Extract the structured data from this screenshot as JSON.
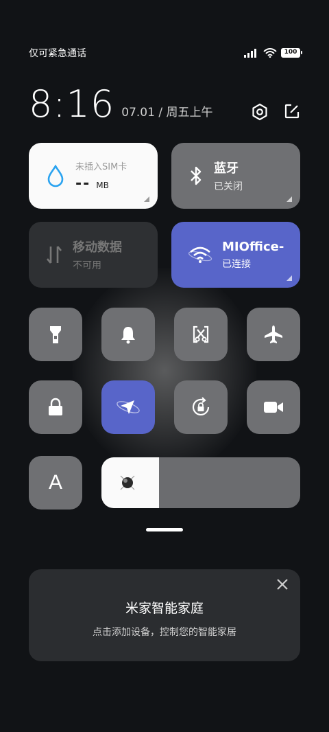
{
  "status_bar": {
    "carrier": "仅可紧急通话",
    "battery": "100"
  },
  "header": {
    "time": "8:16",
    "date": "07.01 / 周五上午"
  },
  "tiles": {
    "data": {
      "title": "未插入SIM卡",
      "value": "--",
      "unit": "MB"
    },
    "bluetooth": {
      "title": "蓝牙",
      "status": "已关闭"
    },
    "mobile_data": {
      "title": "移动数据",
      "status": "不可用"
    },
    "wifi": {
      "title": "MIOffice-",
      "status": "已连接"
    }
  },
  "auto_brightness_label": "A",
  "brightness": {
    "level": 0.29
  },
  "smart_home_card": {
    "title": "米家智能家庭",
    "subtitle": "点击添加设备，控制您的智能家居"
  },
  "colors": {
    "accent": "#5865c9",
    "tile_inactive": "#6f7073",
    "tile_light": "#fafafa",
    "background": "#111316"
  }
}
